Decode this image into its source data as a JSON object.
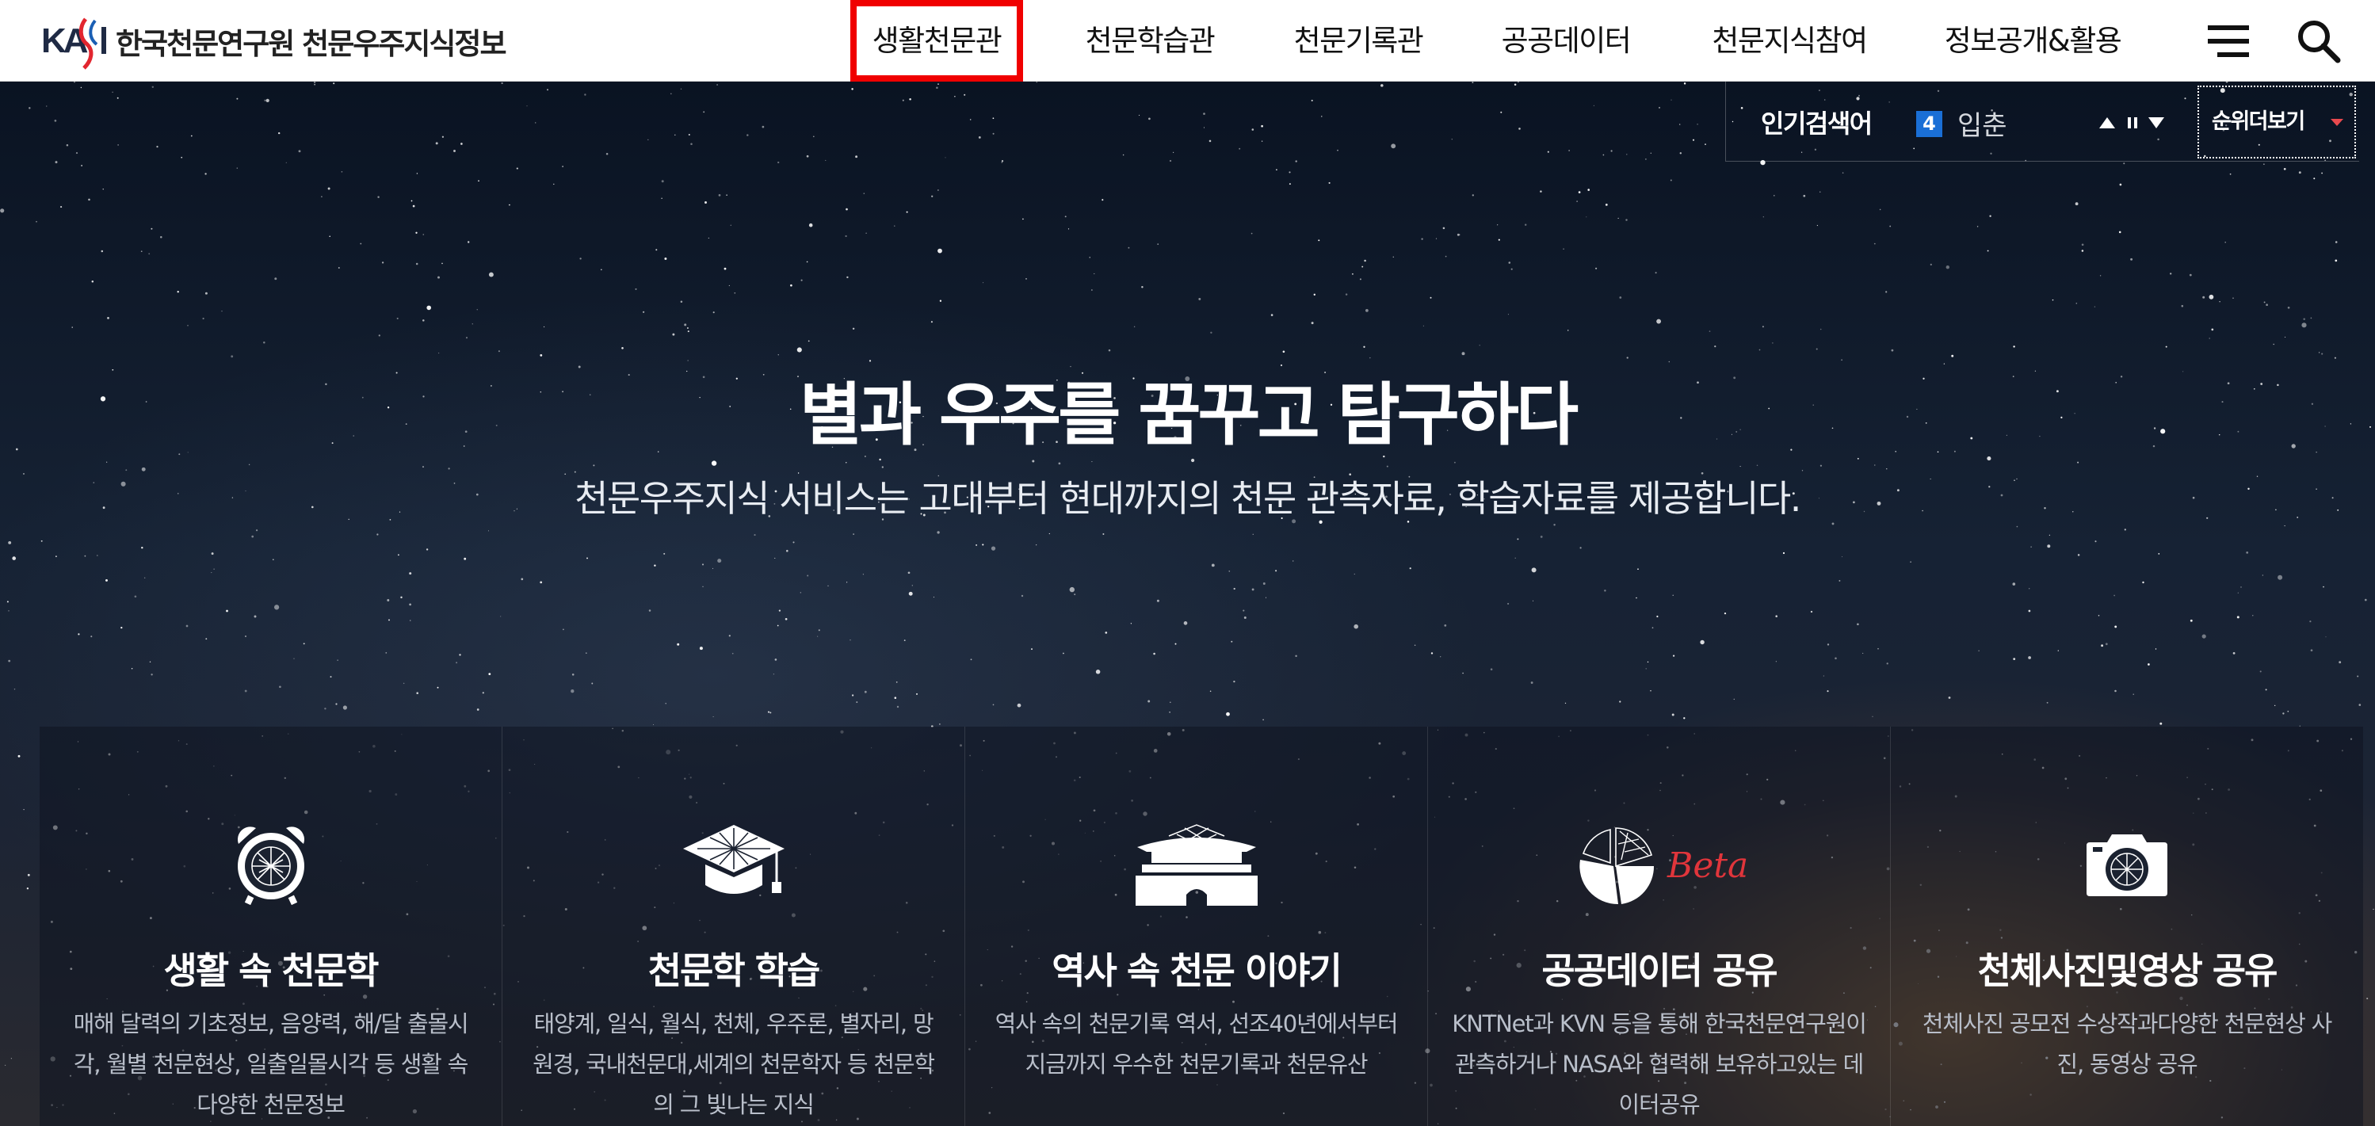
{
  "header": {
    "logo_text": "한국천문연구원 천문우주지식정보",
    "nav": [
      "생활천문관",
      "천문학습관",
      "천문기록관",
      "공공데이터",
      "천문지식참여",
      "정보공개&활용"
    ],
    "active_nav_index": 0,
    "menu_icon": "hamburger-menu-icon",
    "search_icon": "search-icon",
    "active_outline_color": "#f00000"
  },
  "hero": {
    "title": "별과 우주를 꿈꾸고 탐구하다",
    "subtitle": "천문우주지식 서비스는 고대부터 현대까지의 천문 관측자료, 학습자료를 제공합니다."
  },
  "popular_search": {
    "label": "인기검색어",
    "rank": "4",
    "term": "입춘",
    "more_label": "순위더보기",
    "rank_color": "#1a6fd6"
  },
  "cards": [
    {
      "icon": "alarm-clock-icon",
      "title": "생활 속 천문학",
      "desc": "매해 달력의 기초정보, 음양력, 해/달 출몰시각, 월별 천문현상, 일출일몰시각 등 생활 속 다양한 천문정보"
    },
    {
      "icon": "graduation-cap-icon",
      "title": "천문학 학습",
      "desc": "태양계, 일식, 월식, 천체, 우주론, 별자리, 망원경, 국내천문대,세계의 천문학자 등 천문학의 그 빛나는 지식"
    },
    {
      "icon": "palace-gate-icon",
      "title": "역사 속 천문 이야기",
      "desc": "역사 속의 천문기록 역서, 선조40년에서부터 지금까지 우수한 천문기록과 천문유산"
    },
    {
      "icon": "pie-chart-icon",
      "title": "공공데이터 공유",
      "badge": "Beta",
      "desc": "KNTNet과 KVN 등을 통해 한국천문연구원이 관측하거나 NASA와 협력해 보유하고있는 데이터공유"
    },
    {
      "icon": "camera-icon",
      "title": "천체사진및영상 공유",
      "desc": "천체사진 공모전 수상작과다양한 천문현상 사진, 동영상 공유"
    }
  ]
}
